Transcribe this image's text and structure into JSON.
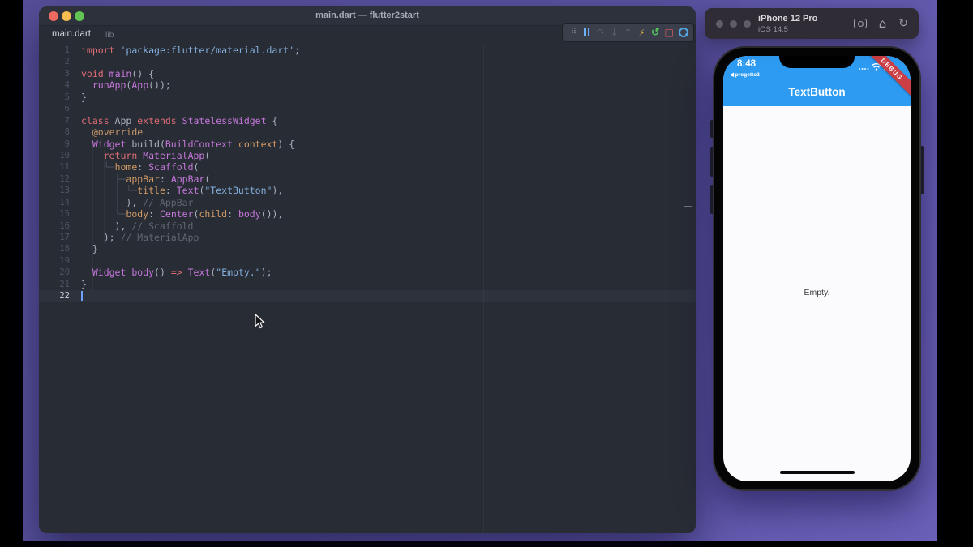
{
  "colors": {
    "desktop": "#5b54a3",
    "editor_bg": "#282c34",
    "titlebar_bg": "#2d313c",
    "keyword": "#e06c75",
    "type": "#c678dd",
    "param": "#d19a66",
    "string": "#85b1e0",
    "comment": "#5f6672",
    "appbar_blue": "#2d9bf2",
    "debug_red": "#cc3e45",
    "traffic": [
      "#ee6a5f",
      "#f5bd4f",
      "#61c454"
    ]
  },
  "editor": {
    "titlebar": {
      "title": "main.dart — flutter2start"
    },
    "tab": {
      "filename": "main.dart",
      "folder": "lib"
    },
    "debug_toolbar": {
      "buttons": [
        {
          "name": "grip",
          "glyph": "⠿",
          "color": "#7e8696"
        },
        {
          "name": "pause",
          "glyph": "",
          "color": "#6fb1ff"
        },
        {
          "name": "step-over",
          "glyph": "↷",
          "color": "#596070"
        },
        {
          "name": "step-into",
          "glyph": "↓",
          "color": "#596070"
        },
        {
          "name": "step-out",
          "glyph": "↑",
          "color": "#596070"
        },
        {
          "name": "hot-reload",
          "glyph": "⚡",
          "color": "#f3c33f"
        },
        {
          "name": "restart",
          "glyph": "↺",
          "color": "#53c45d"
        },
        {
          "name": "stop",
          "glyph": "□",
          "color": "#e25d62"
        },
        {
          "name": "devtools",
          "glyph": "",
          "color": "#55a8e8"
        }
      ]
    },
    "code": {
      "active_line": 22,
      "lines": [
        {
          "n": 1,
          "s": [
            [
              "import",
              "kw"
            ],
            [
              " ",
              "pl"
            ],
            [
              "'package:flutter/material.dart'",
              "str"
            ],
            [
              ";",
              "pl"
            ]
          ]
        },
        {
          "n": 2,
          "s": []
        },
        {
          "n": 3,
          "s": [
            [
              "void",
              "kw"
            ],
            [
              " ",
              "pl"
            ],
            [
              "main",
              "ty"
            ],
            [
              "() {",
              "pl"
            ]
          ]
        },
        {
          "n": 4,
          "s": [
            [
              "  ",
              "pl"
            ],
            [
              "runApp",
              "ty"
            ],
            [
              "(",
              "pl"
            ],
            [
              "App",
              "ty"
            ],
            [
              "());",
              "pl"
            ]
          ]
        },
        {
          "n": 5,
          "s": [
            [
              "}",
              "pl"
            ]
          ]
        },
        {
          "n": 6,
          "s": []
        },
        {
          "n": 7,
          "s": [
            [
              "class",
              "kw"
            ],
            [
              " App ",
              "pl"
            ],
            [
              "extends",
              "kw"
            ],
            [
              " ",
              "pl"
            ],
            [
              "StatelessWidget",
              "ty"
            ],
            [
              " {",
              "pl"
            ]
          ]
        },
        {
          "n": 8,
          "s": [
            [
              "  ",
              "pl"
            ],
            [
              "@override",
              "an"
            ]
          ]
        },
        {
          "n": 9,
          "s": [
            [
              "  ",
              "pl"
            ],
            [
              "Widget",
              "ty"
            ],
            [
              " build(",
              "pl"
            ],
            [
              "BuildContext",
              "ty"
            ],
            [
              " ",
              "pl"
            ],
            [
              "context",
              "pm"
            ],
            [
              ") {",
              "pl"
            ]
          ]
        },
        {
          "n": 10,
          "s": [
            [
              "    ",
              "pl"
            ],
            [
              "return",
              "kw"
            ],
            [
              " ",
              "pl"
            ],
            [
              "MaterialApp",
              "ty"
            ],
            [
              "(",
              "pl"
            ]
          ]
        },
        {
          "n": 11,
          "s": [
            [
              "    ",
              "pl"
            ],
            [
              "└─",
              "gd"
            ],
            [
              "home",
              "pm"
            ],
            [
              ": ",
              "pl"
            ],
            [
              "Scaffold",
              "ty"
            ],
            [
              "(",
              "pl"
            ]
          ]
        },
        {
          "n": 12,
          "s": [
            [
              "      ",
              "pl"
            ],
            [
              "├─",
              "gd"
            ],
            [
              "appBar",
              "pm"
            ],
            [
              ": ",
              "pl"
            ],
            [
              "AppBar",
              "ty"
            ],
            [
              "(",
              "pl"
            ]
          ]
        },
        {
          "n": 13,
          "s": [
            [
              "      ",
              "pl"
            ],
            [
              "│ └─",
              "gd"
            ],
            [
              "title",
              "pm"
            ],
            [
              ": ",
              "pl"
            ],
            [
              "Text",
              "ty"
            ],
            [
              "(",
              "pl"
            ],
            [
              "\"TextButton\"",
              "str"
            ],
            [
              "),",
              "pl"
            ]
          ]
        },
        {
          "n": 14,
          "s": [
            [
              "      ",
              "pl"
            ],
            [
              "│ ",
              "gd"
            ],
            [
              "), ",
              "pl"
            ],
            [
              "// AppBar",
              "cm"
            ]
          ]
        },
        {
          "n": 15,
          "s": [
            [
              "      ",
              "pl"
            ],
            [
              "└─",
              "gd"
            ],
            [
              "body",
              "pm"
            ],
            [
              ": ",
              "pl"
            ],
            [
              "Center",
              "ty"
            ],
            [
              "(",
              "pl"
            ],
            [
              "child",
              "pm"
            ],
            [
              ": ",
              "pl"
            ],
            [
              "body",
              "ty"
            ],
            [
              "()),",
              "pl"
            ]
          ]
        },
        {
          "n": 16,
          "s": [
            [
              "      ), ",
              "pl"
            ],
            [
              "// Scaffold",
              "cm"
            ]
          ]
        },
        {
          "n": 17,
          "s": [
            [
              "    ); ",
              "pl"
            ],
            [
              "// MaterialApp",
              "cm"
            ]
          ]
        },
        {
          "n": 18,
          "s": [
            [
              "  }",
              "pl"
            ]
          ]
        },
        {
          "n": 19,
          "s": []
        },
        {
          "n": 20,
          "s": [
            [
              "  ",
              "pl"
            ],
            [
              "Widget",
              "ty"
            ],
            [
              " ",
              "pl"
            ],
            [
              "body",
              "ty"
            ],
            [
              "() ",
              "pl"
            ],
            [
              "=>",
              "kw"
            ],
            [
              " ",
              "pl"
            ],
            [
              "Text",
              "ty"
            ],
            [
              "(",
              "pl"
            ],
            [
              "\"Empty.\"",
              "str"
            ],
            [
              ");",
              "pl"
            ]
          ]
        },
        {
          "n": 21,
          "s": [
            [
              "}",
              "pl"
            ]
          ]
        },
        {
          "n": 22,
          "s": []
        }
      ]
    }
  },
  "sim": {
    "titlebar": {
      "title": "iPhone 12 Pro",
      "subtitle": "iOS 14.5"
    },
    "icons": [
      "screenshot",
      "home",
      "rotate"
    ]
  },
  "phone": {
    "status": {
      "time": "8:48",
      "back_label": "◀ progetto2"
    },
    "appbar": {
      "title": "TextButton"
    },
    "body": {
      "text": "Empty."
    },
    "debug_banner": "DEBUG"
  }
}
